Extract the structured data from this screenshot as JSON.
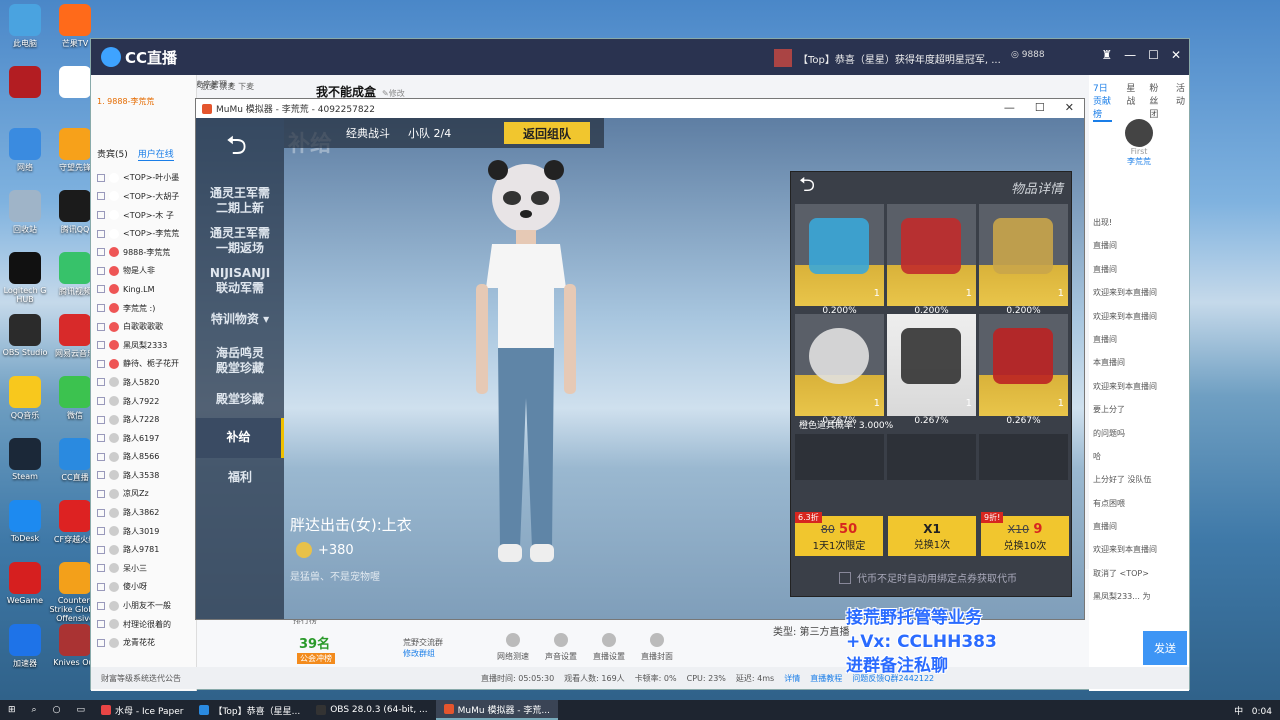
{
  "desktop": {
    "icons": [
      {
        "label": "此电脑",
        "color": "#4aa3e0"
      },
      {
        "label": "芒果TV",
        "color": "#ff6a1a"
      },
      {
        "label": "",
        "color": "#b31d22"
      },
      {
        "label": "",
        "color": "#ffffff"
      },
      {
        "label": "网络",
        "color": "#3a8be0"
      },
      {
        "label": "守望先锋",
        "color": "#f7a11a"
      },
      {
        "label": "回收站",
        "color": "#9fb4c8"
      },
      {
        "label": "腾讯QQ",
        "color": "#1b1b1b"
      },
      {
        "label": "Logitech G HUB",
        "color": "#111111"
      },
      {
        "label": "腾讯视频",
        "color": "#37c26a"
      },
      {
        "label": "OBS Studio",
        "color": "#2b2b2b"
      },
      {
        "label": "网易云音乐",
        "color": "#d82a2a"
      },
      {
        "label": "QQ音乐",
        "color": "#f8c81d"
      },
      {
        "label": "微信",
        "color": "#3cc24f"
      },
      {
        "label": "Steam",
        "color": "#1b2838"
      },
      {
        "label": "CC直播",
        "color": "#2a8ae0"
      },
      {
        "label": "ToDesk",
        "color": "#1d8af0"
      },
      {
        "label": "CF穿越火线",
        "color": "#d22"
      },
      {
        "label": "WeGame",
        "color": "#d61f1f"
      },
      {
        "label": "Counter-Strike Global Offensive",
        "color": "#f3a01a"
      },
      {
        "label": "加速器",
        "color": "#1e73e8"
      },
      {
        "label": "Knives Out",
        "color": "#a33"
      }
    ]
  },
  "cc": {
    "logo": "CC直播",
    "news": "【Top】恭喜（星星）获得年度超明星冠军, ...",
    "coins": "9888",
    "anchor_name": "我不能成盒",
    "anchor_edit": "修改",
    "rank_header": "麦序管理",
    "left_header": "放麦 禁麦 下麦",
    "top_user": "1. 9888-李荒荒",
    "user_tabs": {
      "guests": "贵宾(5)",
      "online": "用户在线"
    },
    "users": [
      "<TOP>-叶小墨",
      "<TOP>-大胡子",
      "<TOP>-木 子",
      "<TOP>-李荒荒",
      "9888-李荒荒",
      "物是人非",
      "King.LM",
      "李荒荒 :)",
      "白歌歌歌歌",
      "黑凤梨2333",
      "静待、栀子花开",
      "路人5820",
      "路人7922",
      "路人7228",
      "路人6197",
      "路人8566",
      "路人3538",
      "凉风Zz",
      "路人3862",
      "路人3019",
      "路人9781",
      "呆小三",
      "傻小呀",
      "小朋友不一般",
      "村理论很着的",
      "龙青花花"
    ],
    "right_tabs": [
      "7日贡献榜",
      "星战",
      "粉丝团",
      "活动"
    ],
    "first_label": "First",
    "first_user": "李荒荒",
    "chat": [
      "出现!",
      "直播间",
      "直播间",
      "欢迎来到本直播间",
      "欢迎来到本直播间",
      "直播间",
      "本直播间",
      "欢迎来到本直播间",
      "要上分了",
      "的问题吗",
      "哈",
      "上分好了 没队伍",
      "有点困喂",
      "直播间",
      "欢迎来到本直播间",
      "取消了 <TOP>",
      "黑凤梨233... 为"
    ],
    "send": "发送",
    "bottom": {
      "rank_label": "排行榜",
      "rank_value": "39名",
      "fans_tag": "公会冲榜",
      "square": "荒野交流群",
      "square_link": "修改群组",
      "tools": [
        "网络测速",
        "声音设置",
        "直播设置",
        "直播封面"
      ],
      "type_label": "类型: 第三方直播"
    },
    "status": {
      "notice": "财富等级系统迭代公告",
      "live_time": "直播时间: 05:05:30",
      "viewers": "观看人数: 169人",
      "lag": "卡顿率: 0%",
      "cpu": "CPU: 23%",
      "delay": "延迟: 4ms",
      "detail": "详情",
      "tutorial": "直播教程",
      "feedback": "问题反馈Q群2442122"
    }
  },
  "mumu": {
    "title": "MuMu 模拟器 - 李荒荒 - 4092257822",
    "game": {
      "mode": "经典战斗",
      "team": "小队 2/4",
      "return_btn": "返回组队",
      "bg_title": "补给",
      "side_items": [
        {
          "label": "通灵王军需\n二期上新"
        },
        {
          "label": "通灵王军需\n一期返场"
        },
        {
          "label": "NIJISANJI\n联动军需"
        },
        {
          "label": "特训物资 ▾"
        },
        {
          "label": "海岳鸣灵\n殿堂珍藏"
        },
        {
          "label": "殿堂珍藏"
        },
        {
          "label": "补给"
        },
        {
          "label": "福利"
        }
      ],
      "active_index": 6,
      "item_name": "胖达出击(女):上衣",
      "item_price": "+380",
      "item_sub": "是猛兽、不是宠物喔",
      "panel": {
        "title": "物品详情",
        "cells": [
          {
            "prob": "0.200%",
            "qty": "1",
            "color": "#3aa7d8"
          },
          {
            "prob": "0.200%",
            "qty": "1",
            "color": "#c12b2b"
          },
          {
            "prob": "0.200%",
            "qty": "1",
            "color": "#c9a54a"
          },
          {
            "prob": "0.267%",
            "qty": "1",
            "color": "#e0e0e0"
          },
          {
            "prob": "0.267%",
            "qty": "1",
            "color": "#333333"
          },
          {
            "prob": "0.267%",
            "qty": "1",
            "color": "#b22"
          }
        ],
        "orange_rate": "橙色道具概率: 3.000%",
        "buy": [
          {
            "tag": "6.3折",
            "line1_old": "80",
            "line1_new": "50",
            "line2": "1天1次限定"
          },
          {
            "tag": "",
            "line1": "X1",
            "line2": "兑换1次"
          },
          {
            "tag": "9折!",
            "line1_old": "X10",
            "line1_new": "9",
            "line2": "兑换10次"
          }
        ],
        "auto_bind": "代币不足时自动用绑定点券获取代币"
      }
    }
  },
  "promo": [
    "接荒野托管等业务",
    "+Vx: CCLHH383",
    "进群备注私聊"
  ],
  "taskbar": {
    "tasks": [
      {
        "label": "水母 - Ice Paper",
        "color": "#e84545"
      },
      {
        "label": "【Top】恭喜（星星...",
        "color": "#2a8ae0"
      },
      {
        "label": "OBS 28.0.3 (64-bit, ...",
        "color": "#333"
      },
      {
        "label": "MuMu 模拟器 - 李荒...",
        "color": "#e4552d"
      }
    ],
    "ime": "中",
    "clock": "0:04"
  }
}
